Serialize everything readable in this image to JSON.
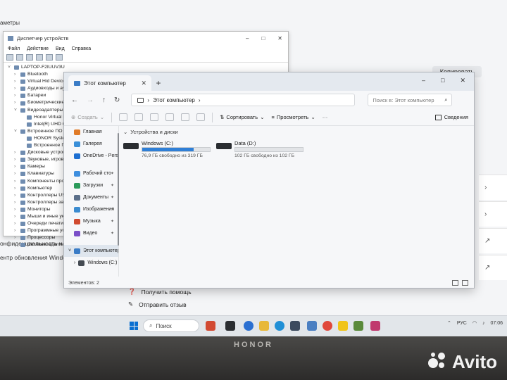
{
  "settings": {
    "top_text": "аметры",
    "copy_button": "Копировать",
    "left_texts": [
      "онфиденциальность и защ",
      "ентр обновления Windows"
    ],
    "help_links": [
      {
        "label": "Получить помощь"
      },
      {
        "label": "Отправить отзыв"
      }
    ]
  },
  "device_manager": {
    "title": "Диспетчер устройств",
    "menu": [
      "Файл",
      "Действие",
      "Вид",
      "Справка"
    ],
    "tree": [
      {
        "label": "LAPTOP-F2IUUV3U",
        "level": 0
      },
      {
        "label": "Bluetooth",
        "level": 1
      },
      {
        "label": "Virtual Hid Device",
        "level": 1
      },
      {
        "label": "Аудиовходы и аудиовыходы",
        "level": 1
      },
      {
        "label": "Батареи",
        "level": 1
      },
      {
        "label": "Биометрические устройства",
        "level": 1
      },
      {
        "label": "Видеоадаптеры",
        "level": 1
      },
      {
        "label": "Honor Virtual Di",
        "level": 2
      },
      {
        "label": "Intel(R) UHD Gra",
        "level": 2
      },
      {
        "label": "Встроенное ПО",
        "level": 1
      },
      {
        "label": "HONOR System",
        "level": 2
      },
      {
        "label": "Встроенное ПО",
        "level": 2
      },
      {
        "label": "Дисковые устройства",
        "level": 1
      },
      {
        "label": "Звуковые, игровые",
        "level": 1
      },
      {
        "label": "Камеры",
        "level": 1
      },
      {
        "label": "Клавиатуры",
        "level": 1
      },
      {
        "label": "Компоненты прог",
        "level": 1
      },
      {
        "label": "Компьютер",
        "level": 1
      },
      {
        "label": "Контроллеры USB",
        "level": 1
      },
      {
        "label": "Контроллеры запо",
        "level": 1
      },
      {
        "label": "Мониторы",
        "level": 1
      },
      {
        "label": "Мыши и иные указ",
        "level": 1
      },
      {
        "label": "Очереди печати",
        "level": 1
      },
      {
        "label": "Программные устр",
        "level": 1
      },
      {
        "label": "Процессоры",
        "level": 1
      },
      {
        "label": "Сетевые адаптеры",
        "level": 1
      }
    ]
  },
  "explorer": {
    "tab_title": "Этот компьютер",
    "breadcrumb": "Этот компьютер",
    "search_placeholder": "Поиск в: Этот компьютер",
    "cmd": {
      "create": "Создать",
      "sort": "Сортировать",
      "view": "Просмотреть",
      "more": "···",
      "details": "Сведения"
    },
    "nav": [
      {
        "label": "Главная",
        "color": "#e07b28",
        "pinned": false
      },
      {
        "label": "Галерея",
        "color": "#3a8fd8",
        "pinned": false
      },
      {
        "label": "OneDrive - Perso",
        "color": "#1d6fd1",
        "pinned": false
      },
      {
        "label": "Рабочий сто",
        "color": "#3e8ede",
        "pinned": true
      },
      {
        "label": "Загрузки",
        "color": "#2b9a5a",
        "pinned": true
      },
      {
        "label": "Документы",
        "color": "#5b6f8a",
        "pinned": true
      },
      {
        "label": "Изображения",
        "color": "#3c8cd0",
        "pinned": true
      },
      {
        "label": "Музыка",
        "color": "#d04a2f",
        "pinned": true
      },
      {
        "label": "Видео",
        "color": "#7a4fc8",
        "pinned": true
      },
      {
        "label": "Этот компьютер",
        "color": "#3a7cc6",
        "pinned": false
      },
      {
        "label": "Windows (C:)",
        "color": "#444a52",
        "pinned": false
      }
    ],
    "group_title": "Устройства и диски",
    "drives": [
      {
        "name": "Windows (C:)",
        "free_text": "76,9 ГБ свободно из 319 ГБ",
        "used_fraction": 0.76
      },
      {
        "name": "Data (D:)",
        "free_text": "102 ГБ свободно из 102 ГБ",
        "used_fraction": 0.0
      }
    ],
    "status": "Элементов: 2"
  },
  "taskbar": {
    "search_label": "Поиск",
    "lang": "РУС",
    "clock": "07:06"
  },
  "device_brand": "HONOR",
  "watermark": "Avito"
}
